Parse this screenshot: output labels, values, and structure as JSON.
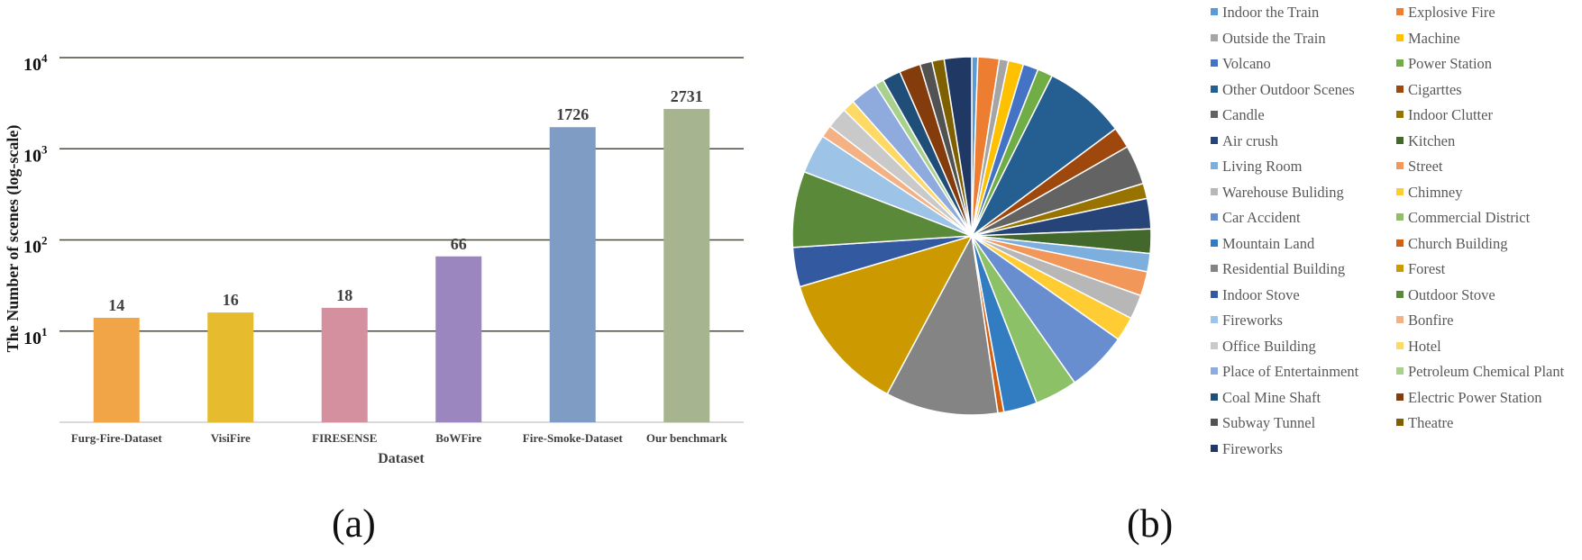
{
  "captions": {
    "a": "(a)",
    "b": "(b)"
  },
  "chart_data": [
    {
      "type": "bar",
      "title": "",
      "xlabel": "Dataset",
      "ylabel": "The Number of scenes (log-scale)",
      "yscale": "log",
      "ylim": [
        1,
        10000
      ],
      "yticks": [
        {
          "value": 10,
          "base": "10",
          "exp": "1"
        },
        {
          "value": 100,
          "base": "10",
          "exp": "2"
        },
        {
          "value": 1000,
          "base": "10",
          "exp": "3"
        },
        {
          "value": 10000,
          "base": "10",
          "exp": "4"
        }
      ],
      "grid": true,
      "categories": [
        "Furg-Fire-Dataset",
        "VisiFire",
        "FIRESENSE",
        "BoWFire",
        "Fire-Smoke-Dataset",
        "Our benchmark"
      ],
      "values": [
        14,
        16,
        18,
        66,
        1726,
        2731
      ],
      "data_labels": [
        "14",
        "16",
        "18",
        "66",
        "1726",
        "2731"
      ],
      "colors": [
        "#F2A546",
        "#E6BC2E",
        "#D4909F",
        "#9B86C0",
        "#7F9DC4",
        "#A6B490"
      ]
    },
    {
      "type": "pie",
      "title": "",
      "start": "top",
      "direction": "clockwise",
      "legend_position": "right",
      "legend_columns": 2,
      "slices": [
        {
          "label": "Indoor the Train",
          "value": 2,
          "color": "#5B9BD5"
        },
        {
          "label": "Explosive Fire",
          "value": 7,
          "color": "#ED7D31"
        },
        {
          "label": "Outside the Train",
          "value": 3,
          "color": "#A5A5A5"
        },
        {
          "label": "Machine",
          "value": 5,
          "color": "#FFC000"
        },
        {
          "label": "Volcano",
          "value": 5,
          "color": "#4472C4"
        },
        {
          "label": "Power Station",
          "value": 5,
          "color": "#70AD47"
        },
        {
          "label": "Other Outdoor Scenes",
          "value": 27,
          "color": "#255E91"
        },
        {
          "label": "Cigarttes",
          "value": 7,
          "color": "#9E480E"
        },
        {
          "label": "Candle",
          "value": 13,
          "color": "#636363"
        },
        {
          "label": "Indoor Clutter",
          "value": 5,
          "color": "#997300"
        },
        {
          "label": "Air crush",
          "value": 10,
          "color": "#264478"
        },
        {
          "label": "Kitchen",
          "value": 8,
          "color": "#43682B"
        },
        {
          "label": "Living Room",
          "value": 6,
          "color": "#7CAFDD"
        },
        {
          "label": "Street",
          "value": 8,
          "color": "#F1975A"
        },
        {
          "label": "Warehouse Buliding",
          "value": 8,
          "color": "#B7B7B7"
        },
        {
          "label": "Chimney",
          "value": 8,
          "color": "#FFCD33"
        },
        {
          "label": "Car Accident",
          "value": 20,
          "color": "#698ED0"
        },
        {
          "label": "Commercial District",
          "value": 14,
          "color": "#8CC168"
        },
        {
          "label": "Mountain Land",
          "value": 11,
          "color": "#327DC2"
        },
        {
          "label": "Church Building",
          "value": 2,
          "color": "#D26012"
        },
        {
          "label": "Residential Building",
          "value": 37,
          "color": "#848484"
        },
        {
          "label": "Forest",
          "value": 46,
          "color": "#CC9A00"
        },
        {
          "label": "Indoor Stove",
          "value": 13,
          "color": "#335AA1"
        },
        {
          "label": "Outdoor Stove",
          "value": 25,
          "color": "#5A8A39"
        },
        {
          "label": "Fireworks",
          "value": 13,
          "color": "#9DC3E6"
        },
        {
          "label": "Bonfire",
          "value": 4,
          "color": "#F4B183"
        },
        {
          "label": "Office Building",
          "value": 7,
          "color": "#C9C9C9"
        },
        {
          "label": "Hotel",
          "value": 4,
          "color": "#FFD966"
        },
        {
          "label": "Place of Entertainment",
          "value": 9,
          "color": "#8FAADC"
        },
        {
          "label": "Petroleum Chemical Plant",
          "value": 3,
          "color": "#A9D18E"
        },
        {
          "label": "Coal Mine Shaft",
          "value": 6,
          "color": "#1F4E79"
        },
        {
          "label": "Electric Power Station",
          "value": 7,
          "color": "#843C0C"
        },
        {
          "label": "Subway Tunnel",
          "value": 4,
          "color": "#525252"
        },
        {
          "label": "Theatre",
          "value": 4,
          "color": "#7F6000"
        },
        {
          "label": "Fireworks",
          "value": 9,
          "color": "#203864"
        }
      ]
    }
  ]
}
